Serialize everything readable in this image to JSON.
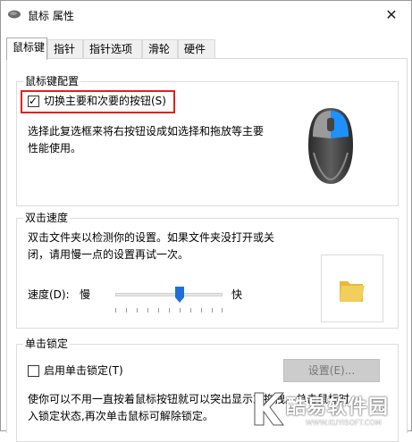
{
  "window": {
    "title": "鼠标 属性"
  },
  "tabs": [
    {
      "label": "鼠标键",
      "active": true
    },
    {
      "label": "指针",
      "active": false
    },
    {
      "label": "指针选项",
      "active": false
    },
    {
      "label": "滑轮",
      "active": false
    },
    {
      "label": "硬件",
      "active": false
    }
  ],
  "button_config": {
    "title": "鼠标键配置",
    "switch_label": "切换主要和次要的按钮(S)",
    "switch_checked": true,
    "description_line1": "选择此复选框来将右按钮设成如选择和拖放等主要",
    "description_line2": "性能使用。"
  },
  "double_click": {
    "title": "双击速度",
    "description_line1": "双击文件夹以检测你的设置。如果文件夹没打开或关",
    "description_line2": "闭，请用慢一点的设置再试一次。",
    "speed_label": "速度(D):",
    "slow_label": "慢",
    "fast_label": "快",
    "speed_level": 0.6
  },
  "click_lock": {
    "title": "单击锁定",
    "enable_label": "启用单击锁定(T)",
    "enabled": false,
    "settings_button": "设置(E)...",
    "description_line1": "使你可以不用一直按着鼠标按钮就可以突出显示或拖拽。单击鼠标时",
    "description_line2": "入锁定状态,再次单击鼠标可解除锁定。"
  },
  "watermark": {
    "text": "酷易软件园",
    "url": "WWW.KUYISOFT.COM"
  },
  "colors": {
    "highlight_border": "#e02020",
    "mouse_accent": "#1e90ff",
    "slider_thumb": "#1e6fd9",
    "folder": "#f2cf5b"
  }
}
